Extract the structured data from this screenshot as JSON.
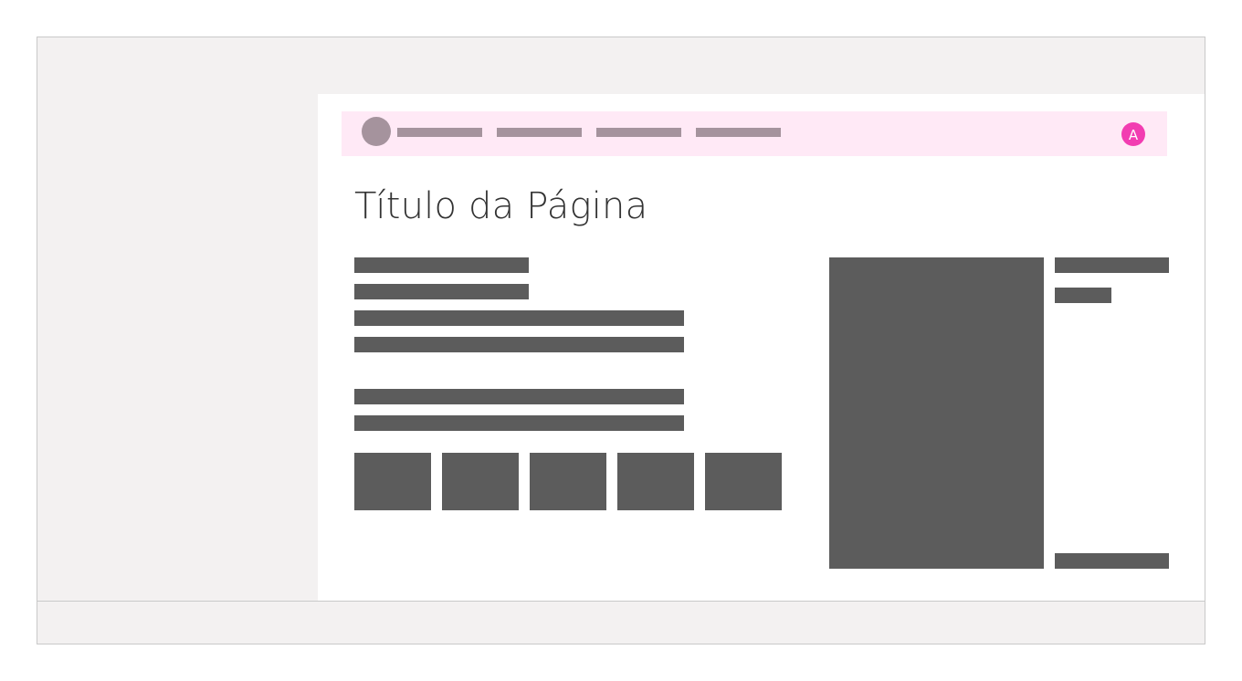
{
  "page": {
    "title": "Título da Página"
  },
  "navbar": {
    "avatar_initial": "A",
    "links": [
      "",
      "",
      "",
      ""
    ]
  },
  "colors": {
    "chrome_background": "#f3f1f1",
    "chrome_border": "#c9c9c9",
    "navbar_background": "#ffe9f6",
    "navbar_placeholder": "#a5939d",
    "avatar_background": "#f23cb1",
    "content_placeholder": "#5c5c5c",
    "title_text": "#333333"
  }
}
